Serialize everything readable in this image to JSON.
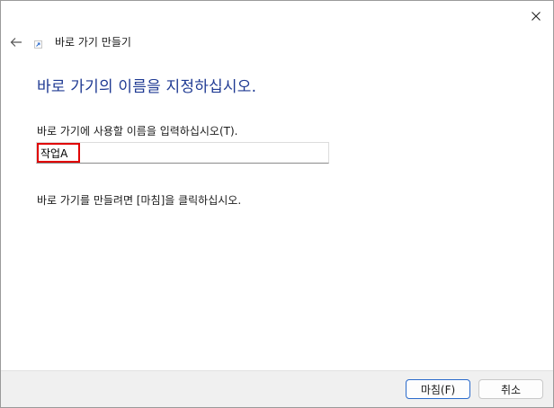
{
  "window": {
    "close_icon": "close-icon"
  },
  "header": {
    "back_icon": "back-arrow-icon",
    "shortcut_icon": "shortcut-arrow-icon",
    "title": "바로 가기 만들기"
  },
  "main": {
    "instruction": "바로 가기의 이름을 지정하십시오.",
    "field_label": "바로 가기에 사용할 이름을 입력하십시오(T).",
    "name_value": "작업A",
    "finish_instruction": "바로 가기를 만들려면 [마침]을 클릭하십시오."
  },
  "footer": {
    "finish_label": "마침(F)",
    "cancel_label": "취소"
  },
  "colors": {
    "instruction_text": "#1f3a93",
    "highlight": "#e00000",
    "default_button_border": "#2a6acb"
  }
}
